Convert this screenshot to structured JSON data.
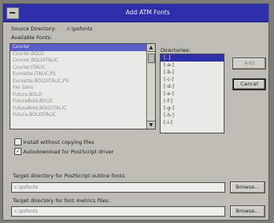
{
  "window": {
    "title": "Add ATM Fonts"
  },
  "source_directory": {
    "label": "Source Directory:",
    "value": "c:\\psfonts"
  },
  "available_fonts": {
    "label": "Available Fonts:",
    "items": [
      "Courier",
      "Courier,BOLD",
      "Courier,BOLDITALIC",
      "Courier,ITALIC",
      "Eurostile,ITALIC,PS",
      "Eurostile,BOLDITALIC,PS",
      "Fax Sans",
      "Futura,BOLD",
      "FuturaBold,BOLD",
      "FuturaBold,BOLDITALIC",
      "Futura,BOLDITALIC"
    ]
  },
  "directories": {
    "label": "Directories:",
    "items": [
      "[..]",
      "[-a-]",
      "[-b-]",
      "[-c-]",
      "[-d-]",
      "[-e-]",
      "[-f-]",
      "[-g-]",
      "[-h-]",
      "[-i-]"
    ]
  },
  "buttons": {
    "add": "Add",
    "cancel": "Cancel",
    "browse1": "Browse...",
    "browse2": "Browse..."
  },
  "options": {
    "install_without_copying": {
      "label": "Install without copying files",
      "checked": false
    },
    "auto_download": {
      "label": "Autodownload for PostScript driver",
      "checked": true
    }
  },
  "target_outline": {
    "label": "Target directory for PostScript outline fonts:",
    "value": "c:\\psfonts"
  },
  "target_metrics": {
    "label": "Target directory for font metrics files:",
    "value": "c:\\psfonts"
  }
}
